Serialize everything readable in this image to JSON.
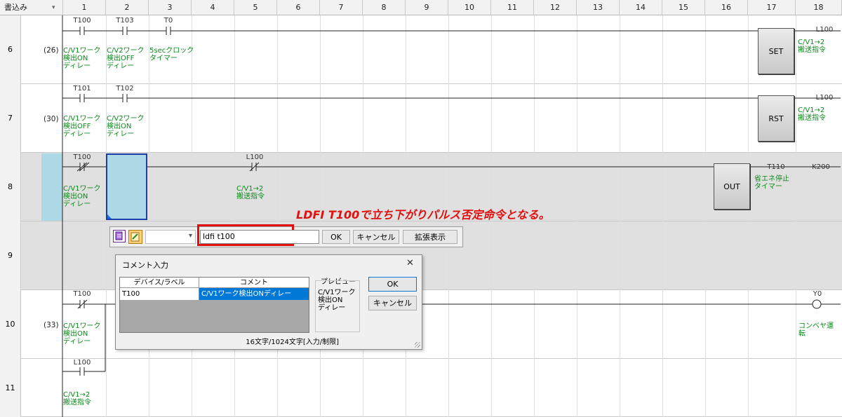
{
  "header": {
    "mode_label": "書込み",
    "dropdown_glyph": "▾",
    "columns": [
      "1",
      "2",
      "3",
      "4",
      "5",
      "6",
      "7",
      "8",
      "9",
      "10",
      "11",
      "12",
      "13",
      "14",
      "15",
      "16",
      "17",
      "18"
    ]
  },
  "rows": [
    {
      "num": "6",
      "step": "(26)"
    },
    {
      "num": "7",
      "step": "(30)"
    },
    {
      "num": "8",
      "step": ""
    },
    {
      "num": "9",
      "step": ""
    },
    {
      "num": "10",
      "step": "(33)"
    },
    {
      "num": "11",
      "step": ""
    }
  ],
  "ladder": {
    "r6": {
      "c1_dev": "T100",
      "c1_cmt": "C/V1ワーク\n検出ON\nディレー",
      "c2_dev": "T103",
      "c2_cmt": "C/V2ワーク\n検出OFF\nディレー",
      "c3_dev": "T0",
      "c3_cmt": "5secクロック\nタイマー",
      "cmd": "SET",
      "out_dev": "L100",
      "out_cmt": "C/V1→2\n搬送指令"
    },
    "r7": {
      "c1_dev": "T101",
      "c1_cmt": "C/V1ワーク\n検出OFF\nディレー",
      "c2_dev": "T102",
      "c2_cmt": "C/V2ワーク\n検出ON\nディレー",
      "cmd": "RST",
      "out_dev": "L100",
      "out_cmt": "C/V1→2\n搬送指令"
    },
    "r8": {
      "c1_dev": "T100",
      "c1_cmt": "C/V1ワーク\n検出ON\nディレー",
      "c5_dev": "L100",
      "c5_cmt": "C/V1→2\n搬送指令",
      "cmd": "OUT",
      "out_dev": "T110",
      "out_cmt": "省エネ停止\nタイマー",
      "out_k": "K200"
    },
    "r10": {
      "c1_dev": "T100",
      "c1_cmt": "C/V1ワーク\n検出ON\nディレー",
      "out_dev": "Y0",
      "out_cmt": "コンベヤ運\n転"
    },
    "r11": {
      "c1_dev": "L100",
      "c1_cmt": "C/V1→2\n搬送指令"
    }
  },
  "annotation": "LDFI T100で立ち下がりパルス否定命令となる。",
  "toolbar": {
    "input_value": "ldfi t100",
    "ok_label": "OK",
    "cancel_label": "キャンセル",
    "expand_label": "拡張表示"
  },
  "comment_dialog": {
    "title": "コメント入力",
    "close_glyph": "✕",
    "col_device": "デバイス/ラベル",
    "col_comment": "コメント",
    "device": "T100",
    "comment": "C/V1ワーク検出ONディレー",
    "preview_label": "プレビュー",
    "preview_text": "C/V1ワーク\n検出ON\nディレー",
    "ok_label": "OK",
    "cancel_label": "キャンセル",
    "status": "16文字/1024文字[入力/制限]"
  },
  "colors": {
    "comment_green": "#0a8a1a",
    "annotation_red": "#e01010",
    "selection_blue": "#add8e6",
    "highlight_gray": "#e0e0e0",
    "dialog_select": "#0078d7"
  }
}
